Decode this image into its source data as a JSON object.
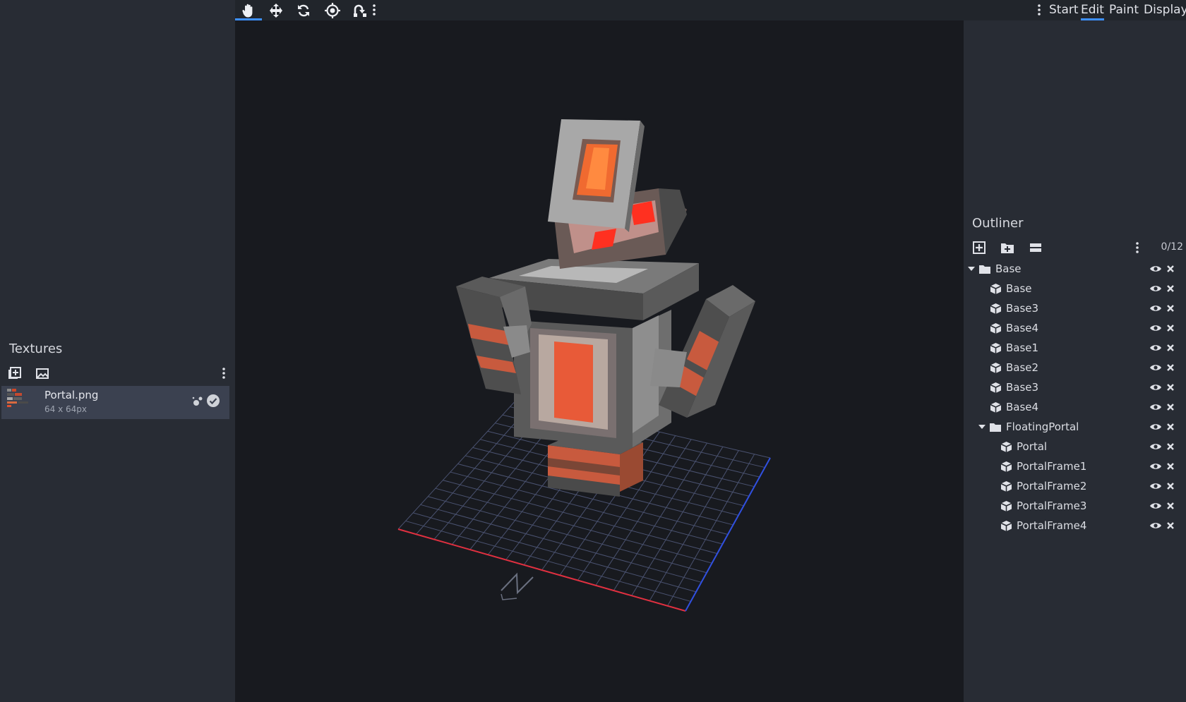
{
  "toolbar": {
    "tools": [
      {
        "name": "move-view-tool",
        "icon": "hand-icon",
        "active": true
      },
      {
        "name": "translate-tool",
        "icon": "move-arrows-icon",
        "active": false
      },
      {
        "name": "rotate-tool",
        "icon": "rotate-icon",
        "active": false
      },
      {
        "name": "pivot-tool",
        "icon": "target-icon",
        "active": false
      },
      {
        "name": "vertex-snap-tool",
        "icon": "vertex-snap-icon",
        "active": false
      }
    ]
  },
  "menu": {
    "tabs": [
      "Start",
      "Edit",
      "Paint",
      "Display"
    ],
    "selected": "Edit"
  },
  "textures": {
    "title": "Textures",
    "items": [
      {
        "name": "Portal.png",
        "size": "64 x 64px"
      }
    ]
  },
  "outliner": {
    "title": "Outliner",
    "count": "0/12",
    "rows": [
      {
        "label": "Base",
        "type": "group",
        "depth": 0,
        "expanded": true
      },
      {
        "label": "Base",
        "type": "cube",
        "depth": 1
      },
      {
        "label": "Base3",
        "type": "cube",
        "depth": 1
      },
      {
        "label": "Base4",
        "type": "cube",
        "depth": 1
      },
      {
        "label": "Base1",
        "type": "cube",
        "depth": 1
      },
      {
        "label": "Base2",
        "type": "cube",
        "depth": 1
      },
      {
        "label": "Base3",
        "type": "cube",
        "depth": 1
      },
      {
        "label": "Base4",
        "type": "cube",
        "depth": 1
      },
      {
        "label": "FloatingPortal",
        "type": "group",
        "depth": 1,
        "expanded": true
      },
      {
        "label": "Portal",
        "type": "cube",
        "depth": 2
      },
      {
        "label": "PortalFrame1",
        "type": "cube",
        "depth": 2
      },
      {
        "label": "PortalFrame2",
        "type": "cube",
        "depth": 2
      },
      {
        "label": "PortalFrame3",
        "type": "cube",
        "depth": 2
      },
      {
        "label": "PortalFrame4",
        "type": "cube",
        "depth": 2
      }
    ]
  },
  "colors": {
    "accent": "#3e90ff",
    "panel": "#282c34",
    "viewport": "#181a1f",
    "grid": "#4a5270",
    "axis_x": "#e03040",
    "axis_z": "#3050e0"
  }
}
